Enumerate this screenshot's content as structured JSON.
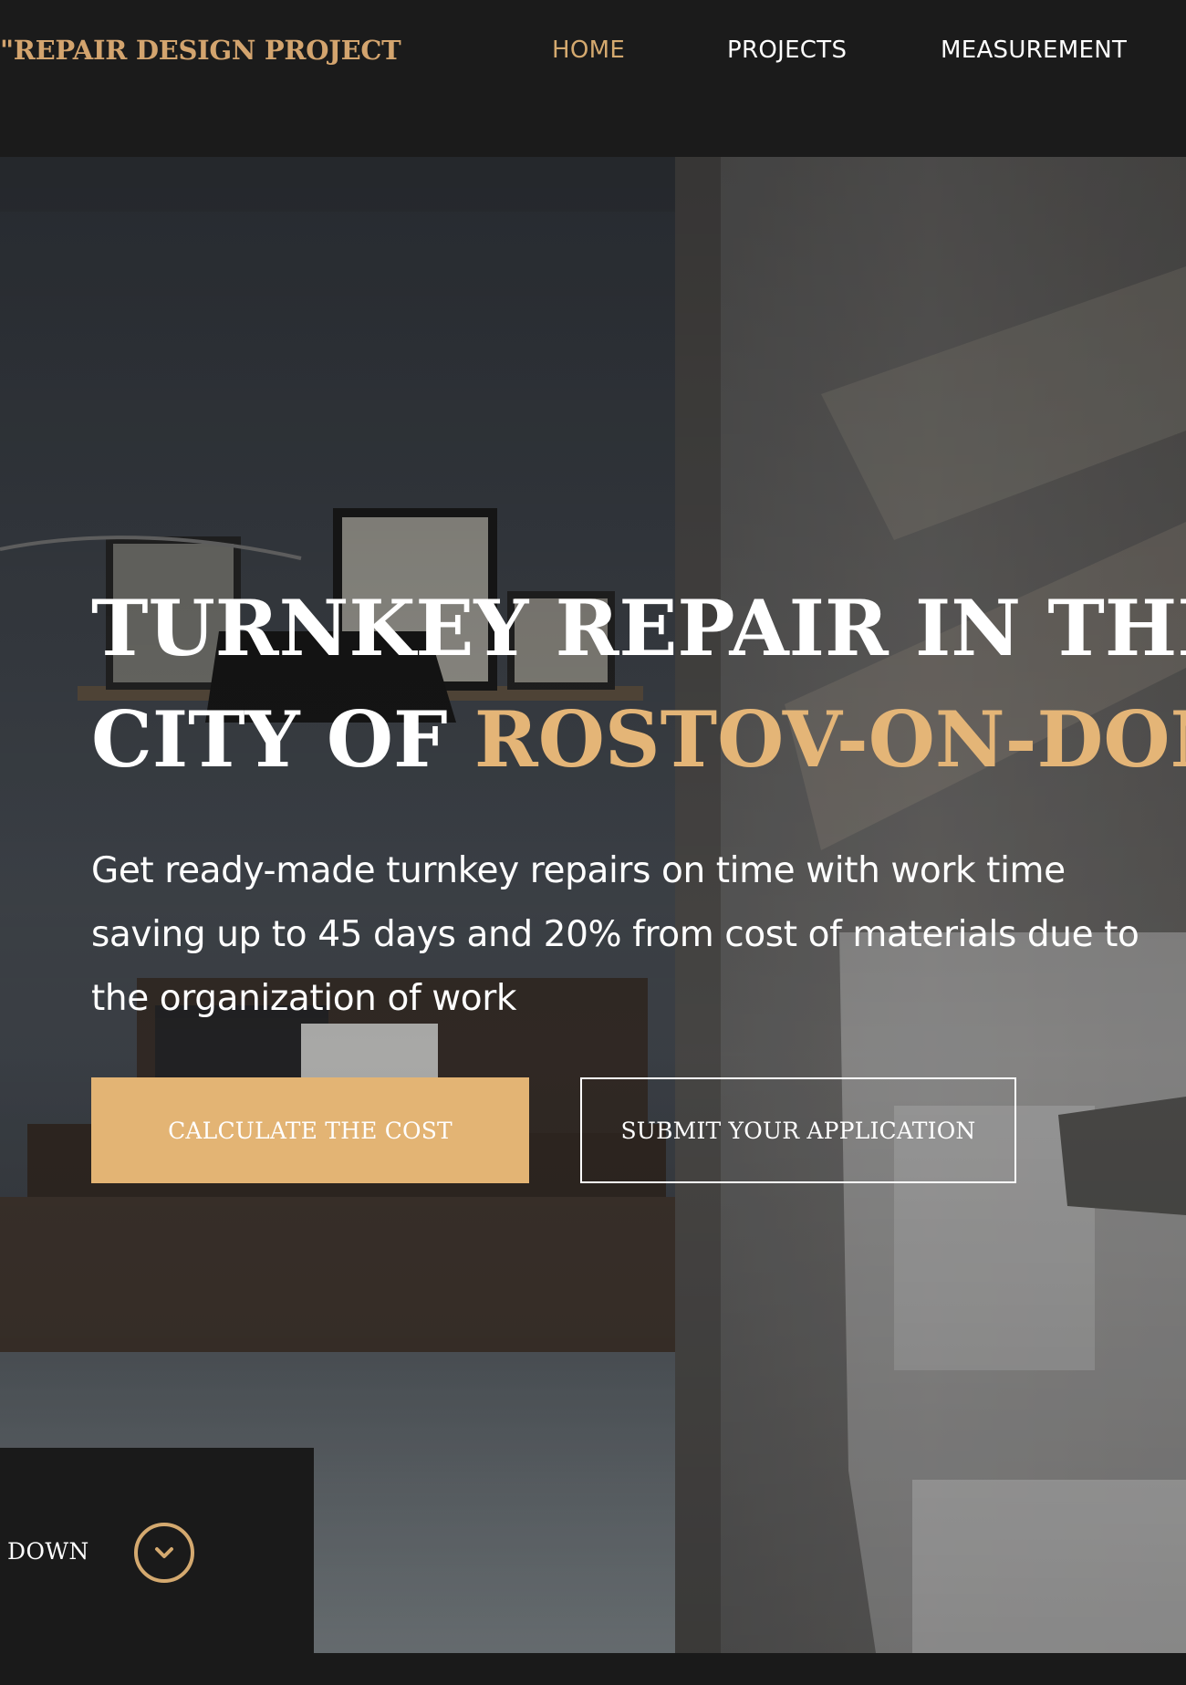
{
  "header": {
    "logo": "\"REPAIR DESIGN PROJECT",
    "nav": [
      {
        "label": "HOME",
        "active": true
      },
      {
        "label": "PROJECTS",
        "active": false
      },
      {
        "label": "MEASUREMENT",
        "active": false
      }
    ]
  },
  "hero": {
    "headline_line1": "TURNKEY REPAIR IN THE",
    "headline_line2_prefix": "CITY OF ",
    "headline_line2_accent": "ROSTOV-ON-DON",
    "subtitle_lines": [
      "Get ready-made turnkey repairs on time with work time",
      "saving up to 45 days and 20% from cost of materials due to",
      "the organization of work"
    ],
    "primary_button": "CALCULATE THE COST",
    "secondary_button": "SUBMIT YOUR APPLICATION"
  },
  "scroll": {
    "label": "DOWN",
    "icon": "chevron-down-circle-icon"
  },
  "colors": {
    "accent": "#e3b474",
    "header_bg": "#1b1b1b",
    "text": "#ffffff"
  }
}
